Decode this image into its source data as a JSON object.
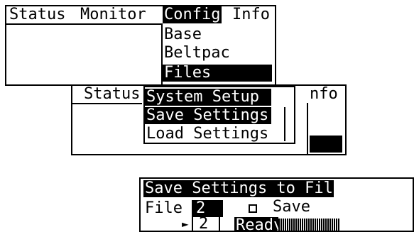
{
  "screen1": {
    "menubar": [
      "Status",
      "Monitor",
      "Config",
      "Info"
    ],
    "dropdown": [
      "Base",
      "Beltpac",
      "Files"
    ]
  },
  "screen2": {
    "menubar": [
      "Status",
      "Info"
    ],
    "menubar_short": [
      "nfo"
    ],
    "dropdown": [
      "System Setup",
      "Save Settings",
      "Load Settings"
    ]
  },
  "screen3": {
    "title": "Save Settings to File",
    "file_label": "File",
    "file_value_selected": "2",
    "file_value_option": "2",
    "save_label": "Save",
    "status": "Ready"
  }
}
